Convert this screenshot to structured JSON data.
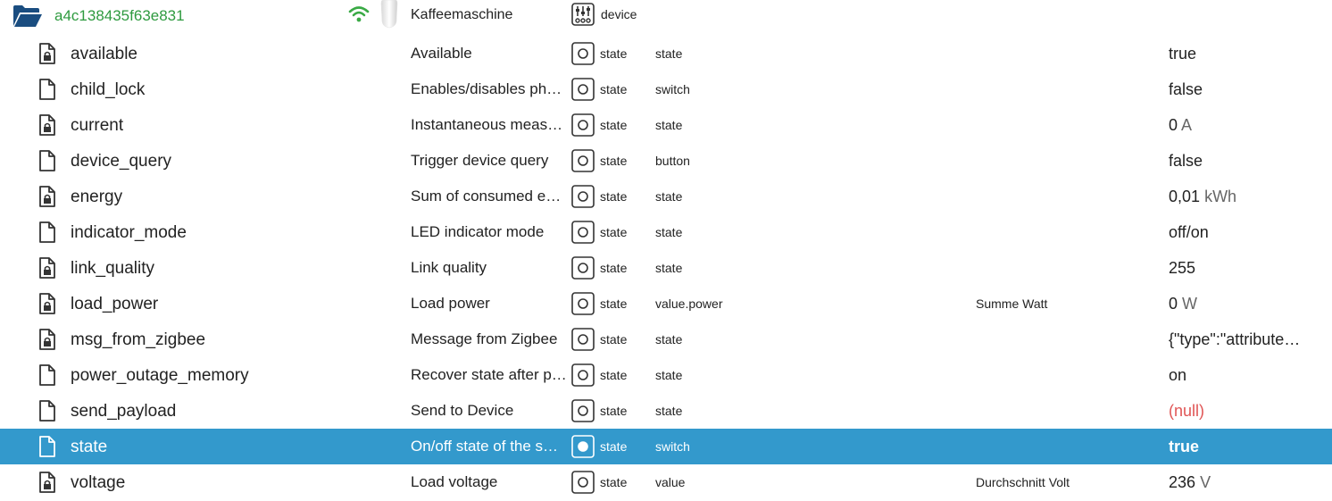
{
  "device": {
    "id": "a4c138435f63e831",
    "name": "Kaffeemaschine",
    "role": "device",
    "folder_icon": "folder-open-icon",
    "signal_icon": "wifi-icon",
    "role_icon": "sliders-icon",
    "colors": {
      "id_text": "#2e9a3f",
      "folder": "#1a4d80",
      "wifi": "#3aaa45",
      "selection": "#3399cc",
      "null_value": "#e05555"
    }
  },
  "rows": [
    {
      "name": "available",
      "description": "Available",
      "type": "state",
      "role": "state",
      "unit_note": "",
      "value": "true",
      "unit": "",
      "icon": "file-lock-icon",
      "selected": false
    },
    {
      "name": "child_lock",
      "description": "Enables/disables phy…",
      "type": "state",
      "role": "switch",
      "unit_note": "",
      "value": "false",
      "unit": "",
      "icon": "file-icon",
      "selected": false
    },
    {
      "name": "current",
      "description": "Instantaneous measu…",
      "type": "state",
      "role": "state",
      "unit_note": "",
      "value": "0",
      "unit": "A",
      "icon": "file-lock-icon",
      "selected": false
    },
    {
      "name": "device_query",
      "description": "Trigger device query",
      "type": "state",
      "role": "button",
      "unit_note": "",
      "value": "false",
      "unit": "",
      "icon": "file-icon",
      "selected": false
    },
    {
      "name": "energy",
      "description": "Sum of consumed en…",
      "type": "state",
      "role": "state",
      "unit_note": "",
      "value": "0,01",
      "unit": "kWh",
      "icon": "file-lock-icon",
      "selected": false
    },
    {
      "name": "indicator_mode",
      "description": "LED indicator mode",
      "type": "state",
      "role": "state",
      "unit_note": "",
      "value": "off/on",
      "unit": "",
      "icon": "file-icon",
      "selected": false
    },
    {
      "name": "link_quality",
      "description": "Link quality",
      "type": "state",
      "role": "state",
      "unit_note": "",
      "value": "255",
      "unit": "",
      "icon": "file-lock-icon",
      "selected": false
    },
    {
      "name": "load_power",
      "description": "Load power",
      "type": "state",
      "role": "value.power",
      "unit_note": "Summe Watt",
      "value": "0",
      "unit": "W",
      "icon": "file-lock-icon",
      "selected": false
    },
    {
      "name": "msg_from_zigbee",
      "description": "Message from Zigbee",
      "type": "state",
      "role": "state",
      "unit_note": "",
      "value": "{\"type\":\"attribute…",
      "unit": "",
      "icon": "file-lock-icon",
      "selected": false
    },
    {
      "name": "power_outage_memory",
      "description": "Recover state after p…",
      "type": "state",
      "role": "state",
      "unit_note": "",
      "value": "on",
      "unit": "",
      "icon": "file-icon",
      "selected": false
    },
    {
      "name": "send_payload",
      "description": "Send to Device",
      "type": "state",
      "role": "state",
      "unit_note": "",
      "value": "(null)",
      "unit": "",
      "icon": "file-icon",
      "selected": false
    },
    {
      "name": "state",
      "description": "On/off state of the s…",
      "type": "state",
      "role": "switch",
      "unit_note": "",
      "value": "true",
      "unit": "",
      "icon": "file-icon",
      "selected": true
    },
    {
      "name": "voltage",
      "description": "Load voltage",
      "type": "state",
      "role": "value",
      "unit_note": "Durchschnitt Volt",
      "value": "236",
      "unit": "V",
      "icon": "file-lock-icon",
      "selected": false
    }
  ]
}
